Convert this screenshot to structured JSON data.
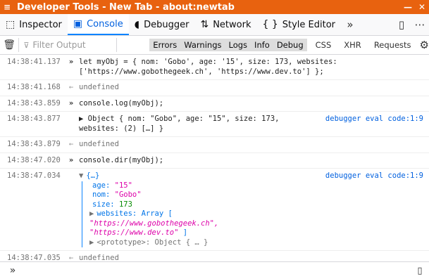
{
  "window": {
    "title": "Developer Tools - New Tab - about:newtab",
    "menu_icon": "≡",
    "minimize": "—",
    "close": "✕"
  },
  "tabs": [
    {
      "label": "Inspector",
      "icon": "⬚"
    },
    {
      "label": "Console",
      "icon": "▣",
      "selected": true
    },
    {
      "label": "Debugger",
      "icon": "◖"
    },
    {
      "label": "Network",
      "icon": "⇅"
    },
    {
      "label": "Style Editor",
      "icon": "{ }"
    }
  ],
  "toolbar": {
    "overflow": "»",
    "split": "▯",
    "more": "⋯"
  },
  "filterbar": {
    "trash_icon": "🗑",
    "placeholder": "Filter Output",
    "filters": [
      "Errors",
      "Warnings",
      "Logs",
      "Info",
      "Debug"
    ],
    "other_filters": [
      "CSS",
      "XHR",
      "Requests"
    ],
    "gear": "⚙"
  },
  "messages": [
    {
      "time": "14:38:41.137",
      "type": "input",
      "line1": "let myObj = { nom: 'Gobo', age: '15', size: 173, websites:",
      "line2": "['https://www.gobothegeek.ch', 'https://www.dev.to'] };"
    },
    {
      "time": "14:38:41.168",
      "type": "output",
      "text": "undefined"
    },
    {
      "time": "14:38:43.859",
      "type": "input",
      "text": "console.log(myObj);"
    },
    {
      "time": "14:38:43.877",
      "type": "log",
      "line1": "▶ Object { nom: \"Gobo\", age: \"15\", size: 173,",
      "line2": "websites: (2) […] }",
      "location": "debugger eval code:1:9"
    },
    {
      "time": "14:38:43.879",
      "type": "output",
      "text": "undefined"
    },
    {
      "time": "14:38:47.020",
      "type": "input",
      "text": "console.dir(myObj);"
    },
    {
      "time": "14:38:47.034",
      "type": "dir",
      "head": "{…}",
      "age_key": "age:",
      "age_val": "\"15\"",
      "nom_key": "nom:",
      "nom_val": "\"Gobo\"",
      "size_key": "size:",
      "size_val": "173",
      "websites_key": "websites:",
      "websites_val": "Array [",
      "w1": "\"https://www.gobothegeek.ch\",",
      "w2": "\"https://www.dev.to\"",
      "w2_end": " ]",
      "proto": "<prototype>: Object { … }",
      "location": "debugger eval code:1:9"
    },
    {
      "time": "14:38:47.035",
      "type": "output",
      "text": "undefined"
    }
  ],
  "bottom": {
    "prompt": "»",
    "sidebar_icon": "▯"
  }
}
